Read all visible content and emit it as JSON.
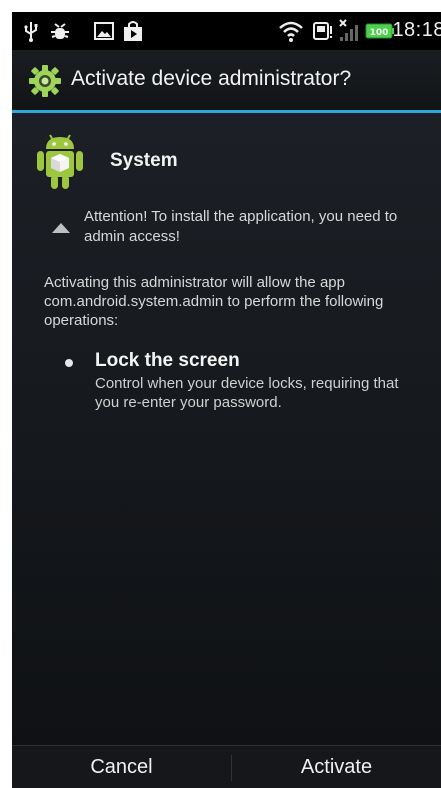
{
  "status_bar": {
    "time": "18:18",
    "icons": [
      "usb-icon",
      "debug-icon",
      "image-icon",
      "shopping-bag-icon",
      "wifi-icon",
      "sd-card-icon",
      "no-signal-icon",
      "battery-icon"
    ],
    "battery_label": "100"
  },
  "title_bar": {
    "icon": "gear-icon",
    "title": "Activate device administrator?",
    "accent_color": "#2da8d8"
  },
  "app": {
    "icon": "android-app-icon",
    "name": "System"
  },
  "warning": {
    "icon": "triangle-icon",
    "text": "Attention! To install the application, you need to admin access!"
  },
  "intro": "Activating this administrator will allow the app com.android.system.admin to perform the following operations:",
  "permissions": [
    {
      "title": "Lock the screen",
      "description": "Control when your device locks, requiring that you re-enter your password."
    }
  ],
  "buttons": {
    "cancel": "Cancel",
    "activate": "Activate"
  }
}
